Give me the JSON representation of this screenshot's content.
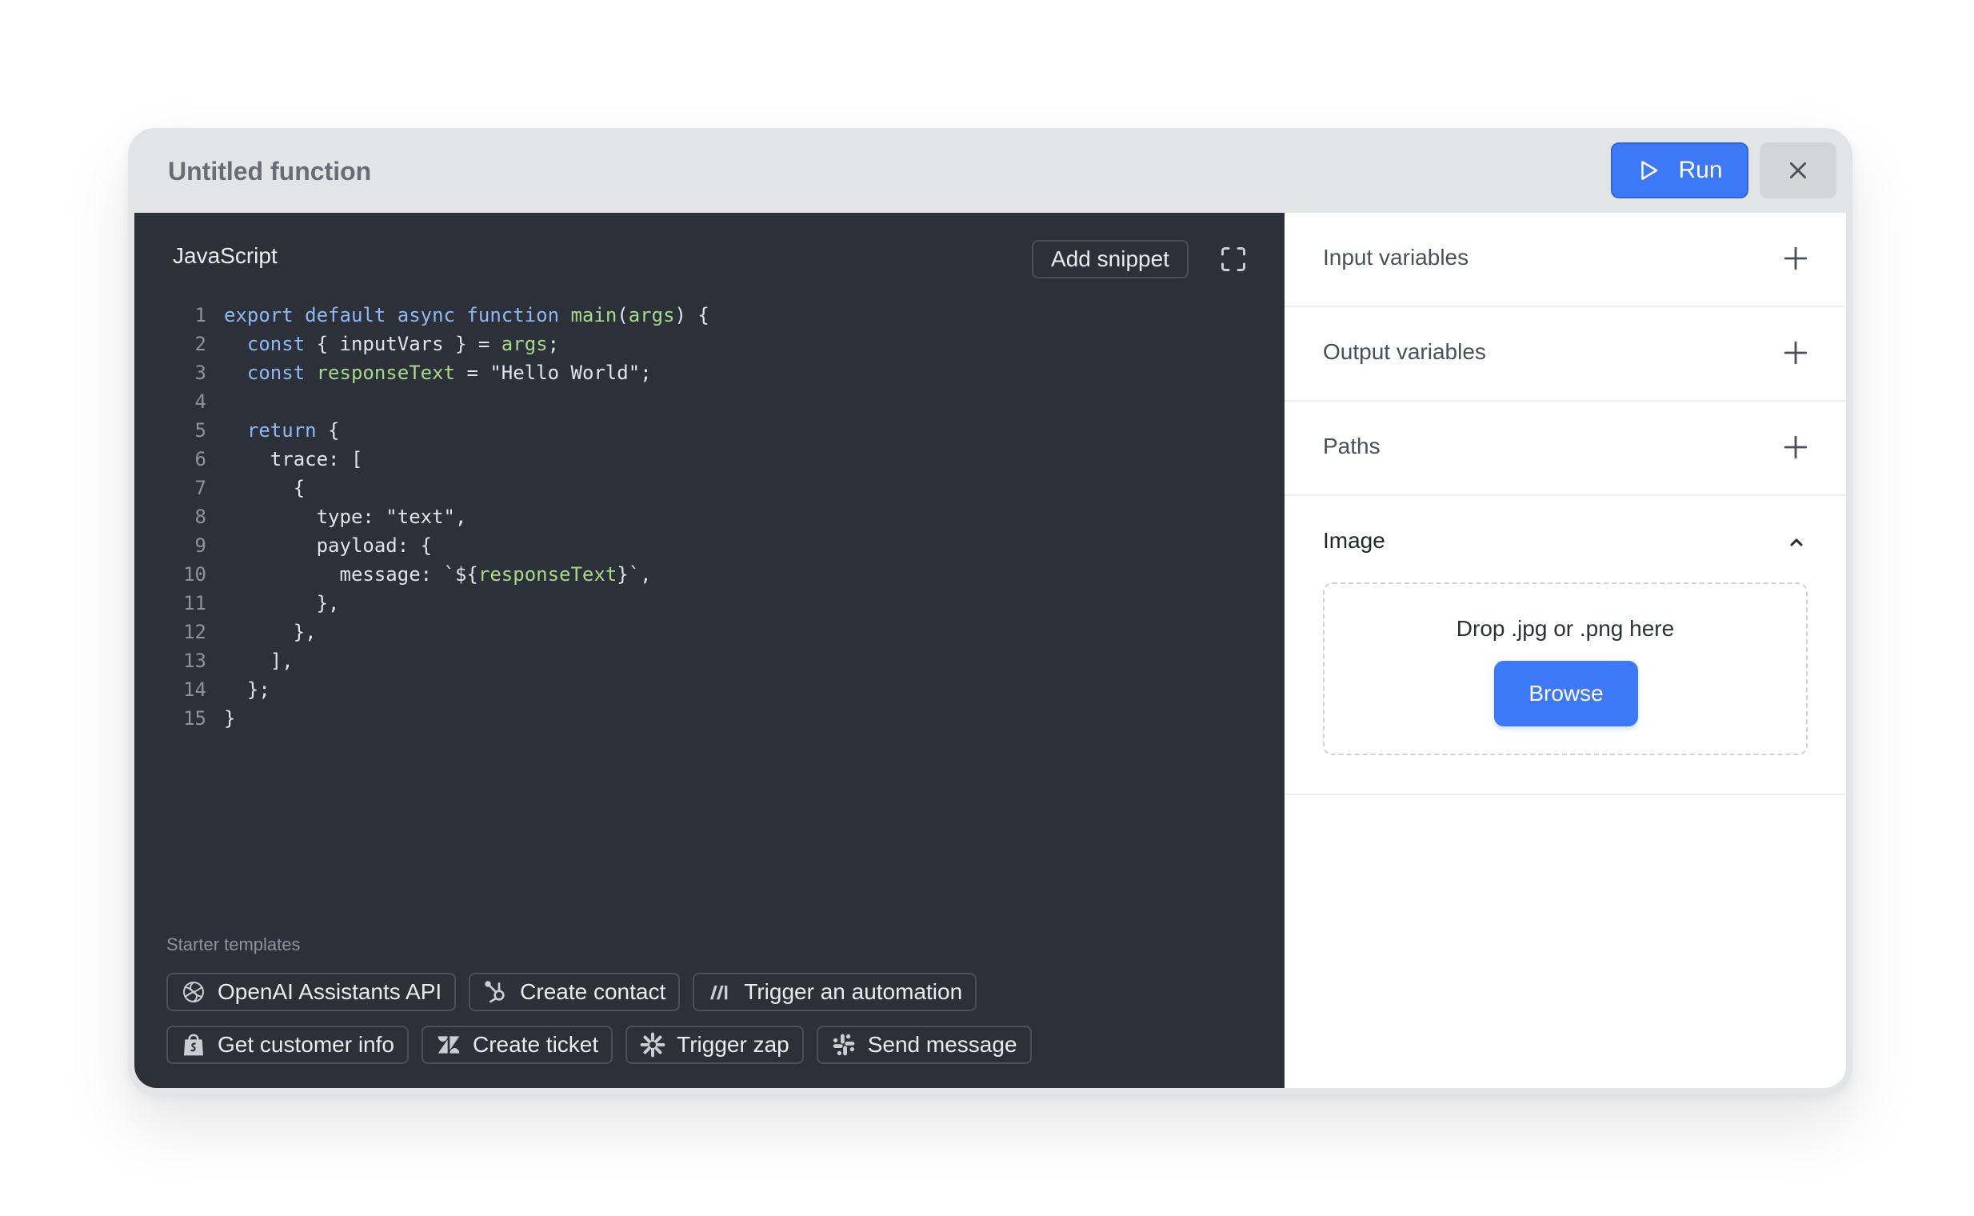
{
  "window": {
    "title": "Untitled function"
  },
  "toolbar": {
    "run_label": "Run"
  },
  "editor": {
    "language": "JavaScript",
    "add_snippet_label": "Add snippet",
    "line_numbers": [
      "1",
      "2",
      "3",
      "4",
      "5",
      "6",
      "7",
      "8",
      "9",
      "10",
      "11",
      "12",
      "13",
      "14",
      "15"
    ],
    "code_lines": [
      "export default async function main(args) {",
      "  const { inputVars } = args;",
      "  const responseText = \"Hello World\";",
      "",
      "  return {",
      "    trace: [",
      "      {",
      "        type: \"text\",",
      "        payload: {",
      "          message: `${responseText}`,",
      "        },",
      "      },",
      "    ],",
      "  };",
      "}"
    ]
  },
  "starter": {
    "label": "Starter templates",
    "templates": [
      {
        "label": "OpenAI Assistants API",
        "icon": "openai-icon"
      },
      {
        "label": "Create contact",
        "icon": "hubspot-icon"
      },
      {
        "label": "Trigger an automation",
        "icon": "make-icon"
      },
      {
        "label": "Get customer info",
        "icon": "shopify-icon"
      },
      {
        "label": "Create ticket",
        "icon": "zendesk-icon"
      },
      {
        "label": "Trigger zap",
        "icon": "zapier-icon"
      },
      {
        "label": "Send message",
        "icon": "slack-icon"
      }
    ]
  },
  "sidebar": {
    "sections": [
      {
        "label": "Input variables"
      },
      {
        "label": "Output variables"
      },
      {
        "label": "Paths"
      }
    ],
    "image": {
      "label": "Image",
      "drop_text": "Drop .jpg or .png here",
      "browse_label": "Browse"
    }
  },
  "colors": {
    "accent": "#3d78f6",
    "editor_bg": "#2c3038",
    "keyword": "#8fb8f2",
    "function": "#a8d88a"
  }
}
